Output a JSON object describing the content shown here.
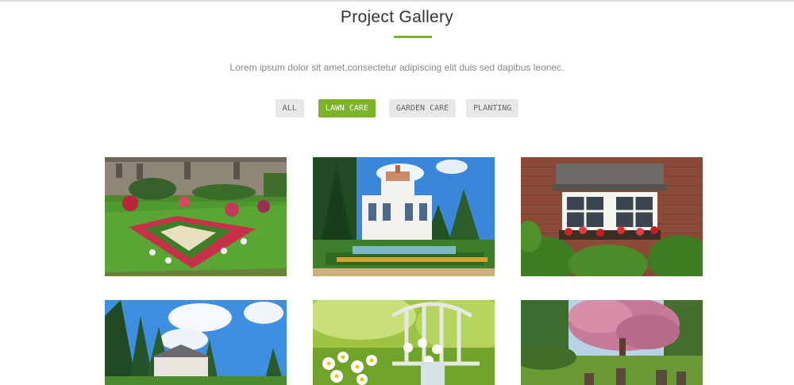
{
  "header": {
    "title": "Project Gallery",
    "subtitle": "Lorem ipsum dolor sit amet,consectetur adipiscing elit duis sed dapibus leonec."
  },
  "filters": {
    "items": [
      {
        "label": "ALL",
        "active": false
      },
      {
        "label": "LAWN CARE",
        "active": true
      },
      {
        "label": "GARDEN CARE",
        "active": false
      },
      {
        "label": "PLANTING",
        "active": false
      }
    ]
  },
  "colors": {
    "accent": "#7cb32a",
    "filter_bg": "#e8e8e8",
    "title_text": "#333333",
    "subtitle_text": "#888888"
  },
  "gallery": {
    "items": [
      {
        "subject": "formal flower garden with stone manor"
      },
      {
        "subject": "white ornate mansion with hedge garden"
      },
      {
        "subject": "brick house window with flower boxes"
      },
      {
        "subject": "house among tall pines under cloudy sky"
      },
      {
        "subject": "white flowers on garden chair"
      },
      {
        "subject": "pink blossom tree over patio furniture"
      }
    ]
  }
}
